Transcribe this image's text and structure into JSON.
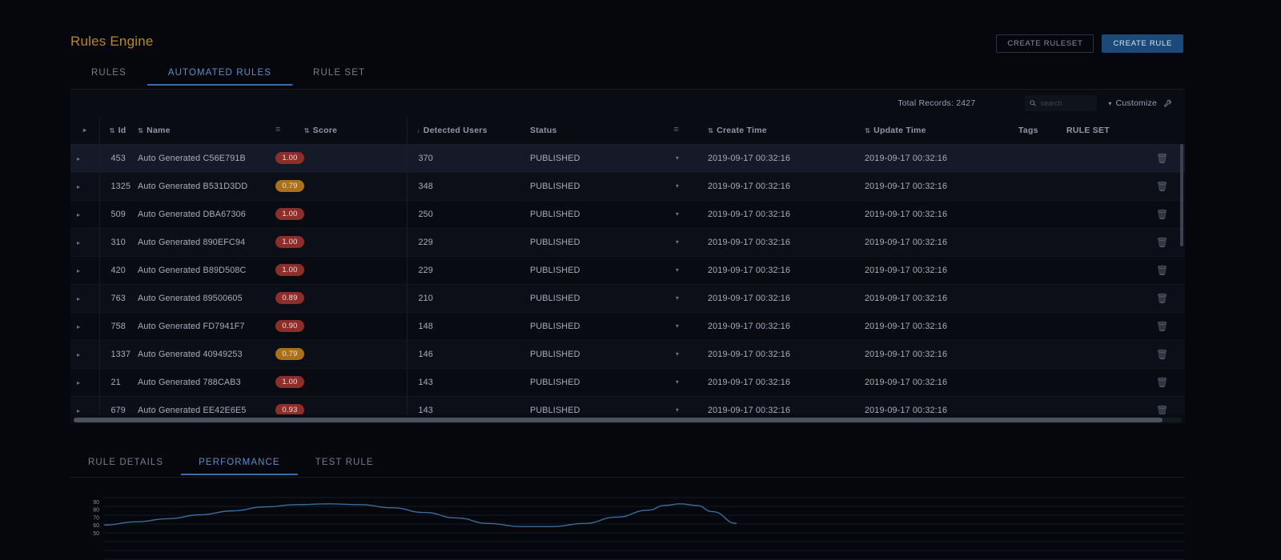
{
  "header": {
    "title": "Rules Engine",
    "create_ruleset_label": "CREATE RULESET",
    "create_rule_label": "CREATE RULE"
  },
  "tabs": [
    {
      "label": "RULES",
      "active": false
    },
    {
      "label": "AUTOMATED RULES",
      "active": true
    },
    {
      "label": "RULE SET",
      "active": false
    }
  ],
  "toolbar": {
    "total_records_label": "Total Records: 2427",
    "search_placeholder": "search",
    "search_value": "",
    "customize_label": "Customize"
  },
  "table": {
    "columns": [
      {
        "key": "expand",
        "label": ""
      },
      {
        "key": "id",
        "label": "Id"
      },
      {
        "key": "name",
        "label": "Name"
      },
      {
        "key": "score",
        "label": "Score"
      },
      {
        "key": "detected_users",
        "label": "Detected Users"
      },
      {
        "key": "status",
        "label": "Status"
      },
      {
        "key": "create_time",
        "label": "Create Time"
      },
      {
        "key": "update_time",
        "label": "Update Time"
      },
      {
        "key": "tags",
        "label": "Tags"
      },
      {
        "key": "rule_set",
        "label": "RULE SET"
      },
      {
        "key": "delete",
        "label": ""
      }
    ],
    "rows": [
      {
        "id": "453",
        "name": "Auto Generated C56E791B",
        "score": "1.00",
        "score_color": "red",
        "detected_users": "370",
        "status": "PUBLISHED",
        "create_time": "2019-09-17 00:32:16",
        "update_time": "2019-09-17 00:32:16",
        "tags": "",
        "rule_set": "",
        "selected": true
      },
      {
        "id": "1325",
        "name": "Auto Generated B531D3DD",
        "score": "0.79",
        "score_color": "amber",
        "detected_users": "348",
        "status": "PUBLISHED",
        "create_time": "2019-09-17 00:32:16",
        "update_time": "2019-09-17 00:32:16",
        "tags": "",
        "rule_set": "",
        "selected": false
      },
      {
        "id": "509",
        "name": "Auto Generated DBA67306",
        "score": "1.00",
        "score_color": "red",
        "detected_users": "250",
        "status": "PUBLISHED",
        "create_time": "2019-09-17 00:32:16",
        "update_time": "2019-09-17 00:32:16",
        "tags": "",
        "rule_set": "",
        "selected": false
      },
      {
        "id": "310",
        "name": "Auto Generated 890EFC94",
        "score": "1.00",
        "score_color": "red",
        "detected_users": "229",
        "status": "PUBLISHED",
        "create_time": "2019-09-17 00:32:16",
        "update_time": "2019-09-17 00:32:16",
        "tags": "",
        "rule_set": "",
        "selected": false
      },
      {
        "id": "420",
        "name": "Auto Generated B89D508C",
        "score": "1.00",
        "score_color": "red",
        "detected_users": "229",
        "status": "PUBLISHED",
        "create_time": "2019-09-17 00:32:16",
        "update_time": "2019-09-17 00:32:16",
        "tags": "",
        "rule_set": "",
        "selected": false
      },
      {
        "id": "763",
        "name": "Auto Generated 89500605",
        "score": "0.89",
        "score_color": "red",
        "detected_users": "210",
        "status": "PUBLISHED",
        "create_time": "2019-09-17 00:32:16",
        "update_time": "2019-09-17 00:32:16",
        "tags": "",
        "rule_set": "",
        "selected": false
      },
      {
        "id": "758",
        "name": "Auto Generated FD7941F7",
        "score": "0.90",
        "score_color": "red",
        "detected_users": "148",
        "status": "PUBLISHED",
        "create_time": "2019-09-17 00:32:16",
        "update_time": "2019-09-17 00:32:16",
        "tags": "",
        "rule_set": "",
        "selected": false
      },
      {
        "id": "1337",
        "name": "Auto Generated 40949253",
        "score": "0.79",
        "score_color": "amber",
        "detected_users": "146",
        "status": "PUBLISHED",
        "create_time": "2019-09-17 00:32:16",
        "update_time": "2019-09-17 00:32:16",
        "tags": "",
        "rule_set": "",
        "selected": false
      },
      {
        "id": "21",
        "name": "Auto Generated 788CAB3",
        "score": "1.00",
        "score_color": "red",
        "detected_users": "143",
        "status": "PUBLISHED",
        "create_time": "2019-09-17 00:32:16",
        "update_time": "2019-09-17 00:32:16",
        "tags": "",
        "rule_set": "",
        "selected": false
      },
      {
        "id": "679",
        "name": "Auto Generated EE42E6E5",
        "score": "0.93",
        "score_color": "red",
        "detected_users": "143",
        "status": "PUBLISHED",
        "create_time": "2019-09-17 00:32:16",
        "update_time": "2019-09-17 00:32:16",
        "tags": "",
        "rule_set": "",
        "selected": false
      }
    ]
  },
  "bottom_tabs": [
    {
      "label": "RULE DETAILS",
      "active": false
    },
    {
      "label": "PERFORMANCE",
      "active": true
    },
    {
      "label": "TEST RULE",
      "active": false
    }
  ],
  "chart_data": {
    "type": "line",
    "title": "",
    "xlabel": "",
    "ylabel": "",
    "ylim": [
      50,
      95
    ],
    "yticks": [
      90,
      80,
      70,
      60,
      50
    ],
    "grid": true,
    "legend": "none",
    "line_color": "#3d6b9c",
    "series": [
      {
        "name": "performance",
        "x": [
          0,
          40,
          80,
          120,
          160,
          200,
          240,
          280,
          320,
          360,
          400,
          440,
          480,
          520,
          560,
          600,
          640,
          680
        ],
        "values": [
          60,
          64,
          68,
          73,
          78,
          83,
          86,
          87,
          86,
          82,
          76,
          69,
          62,
          58,
          58,
          62,
          70,
          79
        ]
      }
    ],
    "series_tail": {
      "x": [
        680,
        700,
        720,
        740,
        760,
        790
      ],
      "values": [
        79,
        85,
        87,
        85,
        77,
        62
      ]
    }
  },
  "icons": {
    "search": "search-icon",
    "customize_chevron": "chevron-down-icon",
    "customize_tool": "wrench-icon",
    "sort": "sort-icon",
    "filter": "filter-icon",
    "expand": "expand-row-icon",
    "status_caret": "chevron-down-icon",
    "delete": "trash-icon"
  }
}
